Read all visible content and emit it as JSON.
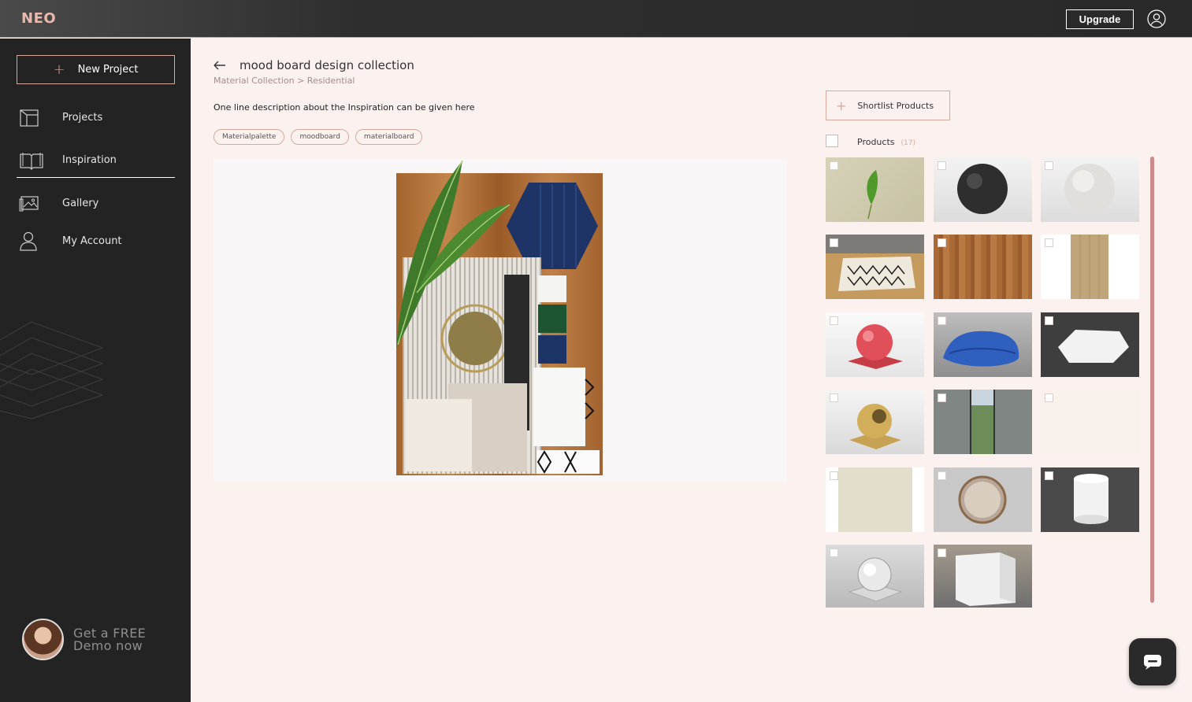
{
  "app": {
    "logo": "NEO",
    "upgrade_label": "Upgrade"
  },
  "sidebar": {
    "new_project_label": "New Project",
    "items": [
      {
        "label": "Projects",
        "icon": "projects-icon"
      },
      {
        "label": "Inspiration",
        "icon": "book-icon",
        "active": true
      },
      {
        "label": "Gallery",
        "icon": "gallery-icon"
      },
      {
        "label": "My Account",
        "icon": "user-icon"
      }
    ],
    "demo": {
      "line1": "Get a FREE",
      "line2": "Demo now"
    }
  },
  "main": {
    "title": "mood board design collection",
    "breadcrumb": "Material Collection > Residential",
    "description": "One line description about the Inspiration can be given here",
    "tags": [
      "Materialpalette",
      "moodboard",
      "materialboard"
    ]
  },
  "products": {
    "shortlist_label": "Shortlist Products",
    "label": "Products",
    "count": "(17)",
    "items": [
      "leaf-on-fabric",
      "dark-sphere",
      "white-sphere",
      "patterned-rug",
      "wood-planks",
      "oak-panel",
      "red-sphere",
      "blue-towel",
      "white-hexagon",
      "gold-sphere",
      "window-view",
      "blank-cream",
      "cream-panel",
      "round-mirror",
      "white-cylinder",
      "glass-sphere",
      "white-cube"
    ]
  },
  "colors": {
    "accent": "#d7a99c",
    "sidebar": "#232323",
    "background": "#fbf1ef",
    "scrollbar": "#c98b8b"
  }
}
